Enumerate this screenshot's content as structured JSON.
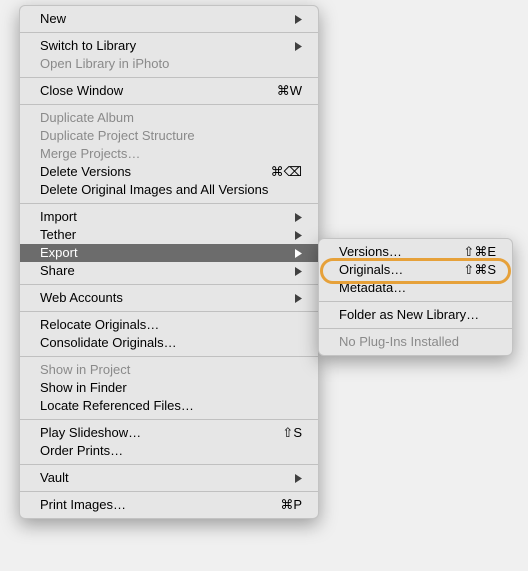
{
  "menu": {
    "new": "New",
    "switch_to_library": "Switch to Library",
    "open_library_in_iphoto": "Open Library in iPhoto",
    "close_window": "Close Window",
    "close_window_sc": "⌘W",
    "duplicate_album": "Duplicate Album",
    "duplicate_project_structure": "Duplicate Project Structure",
    "merge_projects": "Merge Projects…",
    "delete_versions": "Delete Versions",
    "delete_versions_sc": "⌘⌫",
    "delete_original_images": "Delete Original Images and All Versions",
    "import": "Import",
    "tether": "Tether",
    "export": "Export",
    "share": "Share",
    "web_accounts": "Web Accounts",
    "relocate_originals": "Relocate Originals…",
    "consolidate_originals": "Consolidate Originals…",
    "show_in_project": "Show in Project",
    "show_in_finder": "Show in Finder",
    "locate_referenced_files": "Locate Referenced Files…",
    "play_slideshow": "Play Slideshow…",
    "play_slideshow_sc": "⇧S",
    "order_prints": "Order Prints…",
    "vault": "Vault",
    "print_images": "Print Images…",
    "print_images_sc": "⌘P"
  },
  "submenu": {
    "versions": "Versions…",
    "versions_sc": "⇧⌘E",
    "originals": "Originals…",
    "originals_sc": "⇧⌘S",
    "metadata": "Metadata…",
    "folder_as_new_library": "Folder as New Library…",
    "no_plugins": "No Plug-Ins Installed"
  }
}
